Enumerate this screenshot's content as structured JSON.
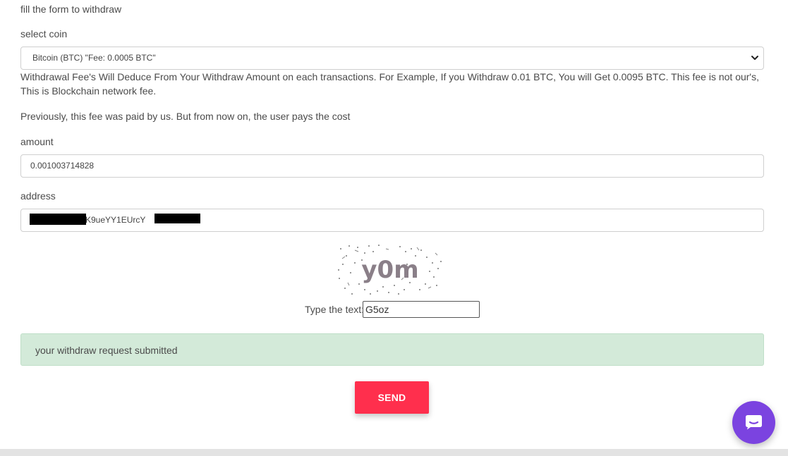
{
  "form": {
    "intro": "fill the form to withdraw",
    "coin_label": "select coin",
    "coin_selected": "Bitcoin (BTC) \"Fee: 0.0005 BTC\"",
    "fee_notice": "Withdrawal Fee's Will Deduce From Your Withdraw Amount on each transactions. For Example, If you Withdraw 0.01 BTC, You will Get 0.0095 BTC. This fee is not our's, This is Blockchain network fee.",
    "fee_history": "Previously, this fee was paid by us. But from now on, the user pays the cost",
    "amount_label": "amount",
    "amount_value": "0.001003714828",
    "address_label": "address",
    "address_visible": "K9ueYY1EUrcY",
    "captcha_text": "y0m",
    "captcha_label": "Type the text:",
    "captcha_input": "G5oz",
    "alert_message": "your withdraw request submitted",
    "send_label": "SEND"
  },
  "icons": {
    "coin_dropdown": "chevron-down-icon",
    "chat": "chat-bubble-icon"
  },
  "colors": {
    "send_button": "#ff2f4d",
    "alert_bg": "#d3ead9",
    "chat_bubble": "#7b43e0"
  }
}
